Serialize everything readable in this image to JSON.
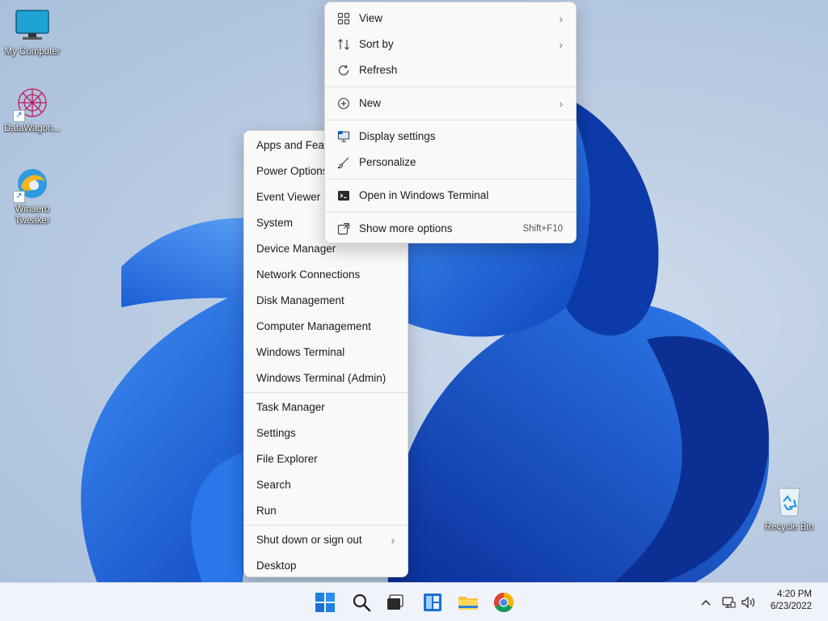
{
  "desktop": {
    "icons": [
      {
        "label": "My Computer"
      },
      {
        "label": "DataWagon..."
      },
      {
        "label": "Winaero Tweaker"
      },
      {
        "label": "Recycle Bin"
      }
    ]
  },
  "winx_menu": {
    "items": [
      {
        "label": "Apps and Features"
      },
      {
        "label": "Power Options"
      },
      {
        "label": "Event Viewer"
      },
      {
        "label": "System"
      },
      {
        "label": "Device Manager"
      },
      {
        "label": "Network Connections"
      },
      {
        "label": "Disk Management"
      },
      {
        "label": "Computer Management"
      },
      {
        "label": "Windows Terminal"
      },
      {
        "label": "Windows Terminal (Admin)"
      },
      {
        "label": "Task Manager"
      },
      {
        "label": "Settings"
      },
      {
        "label": "File Explorer"
      },
      {
        "label": "Search"
      },
      {
        "label": "Run"
      },
      {
        "label": "Shut down or sign out"
      },
      {
        "label": "Desktop"
      }
    ]
  },
  "context_menu": {
    "items": [
      {
        "label": "View",
        "icon": "grid-icon",
        "submenu": true
      },
      {
        "label": "Sort by",
        "icon": "sort-icon",
        "submenu": true
      },
      {
        "label": "Refresh",
        "icon": "refresh-icon"
      },
      {
        "label": "New",
        "icon": "plus-circle-icon",
        "submenu": true
      },
      {
        "label": "Display settings",
        "icon": "display-icon"
      },
      {
        "label": "Personalize",
        "icon": "brush-icon"
      },
      {
        "label": "Open in Windows Terminal",
        "icon": "terminal-icon"
      },
      {
        "label": "Show more options",
        "icon": "more-options-icon",
        "shortcut": "Shift+F10"
      }
    ]
  },
  "taskbar": {
    "clock_time": "4:20 PM",
    "clock_date": "6/23/2022",
    "pinned": [
      "start-icon",
      "search-icon",
      "task-view-icon",
      "widgets-icon",
      "file-explorer-icon",
      "chrome-icon"
    ],
    "tray": [
      "chevron-up-icon",
      "network-icon",
      "volume-icon"
    ]
  },
  "colors": {
    "accent": "#0067c0",
    "wallpaper_blue": "#1565d8",
    "menu_bg": "#f9f9f9"
  }
}
